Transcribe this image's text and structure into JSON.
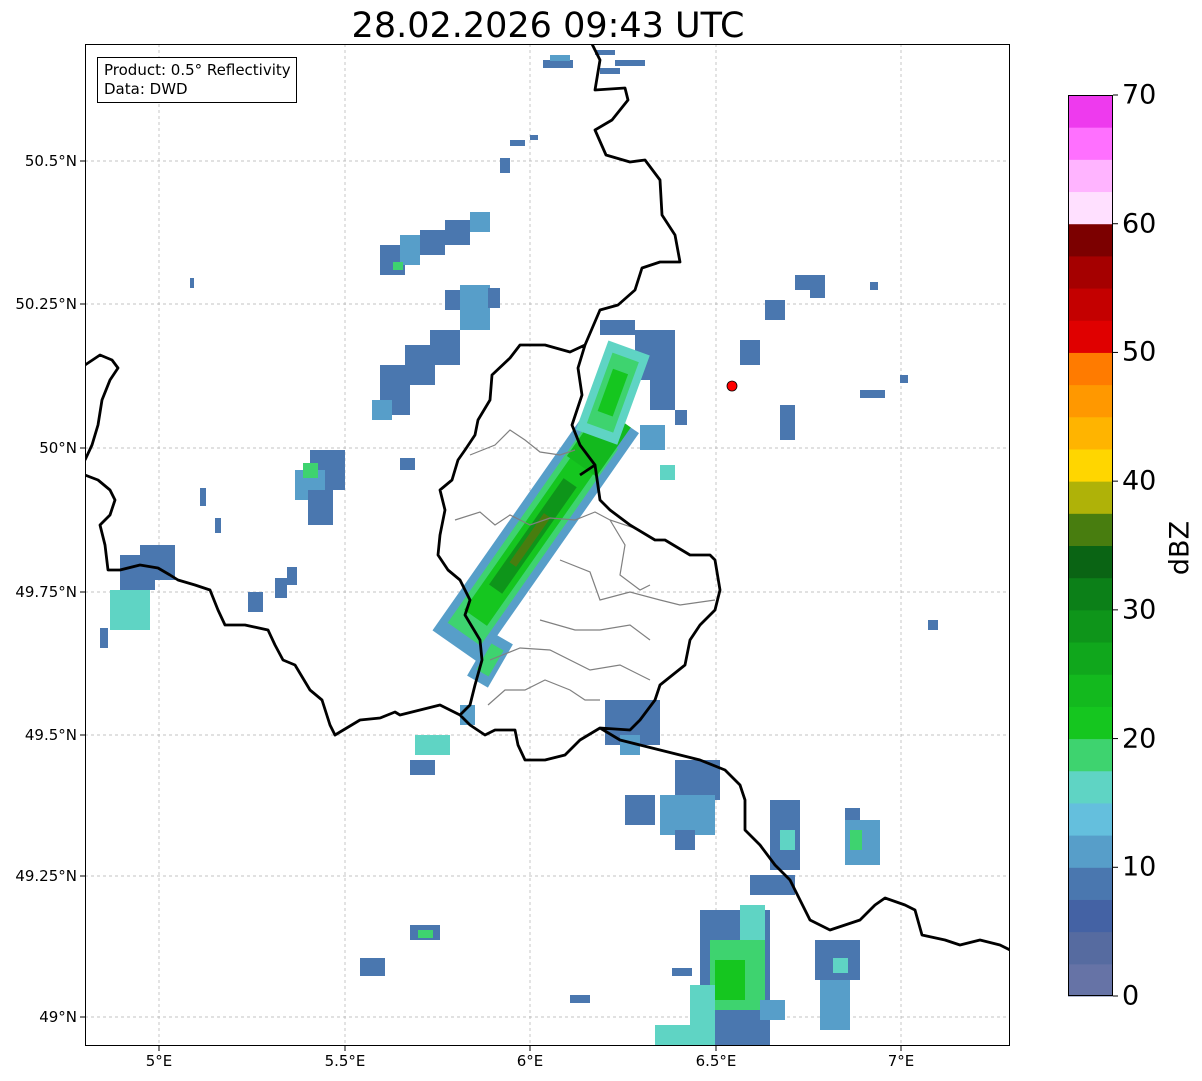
{
  "title": "28.02.2026 09:43 UTC",
  "infobox": {
    "product": "Product: 0.5° Reflectivity",
    "data": "Data: DWD"
  },
  "axes": {
    "x_ticks": [
      "5°E",
      "5.5°E",
      "6°E",
      "6.5°E",
      "7°E"
    ],
    "y_ticks": [
      "50.5°N",
      "50.25°N",
      "50°N",
      "49.75°N",
      "49.5°N",
      "49.25°N",
      "49°N"
    ]
  },
  "colorbar": {
    "label": "dBZ",
    "ticks": [
      "0",
      "10",
      "20",
      "30",
      "40",
      "50",
      "60",
      "70"
    ],
    "range": [
      0,
      70
    ],
    "colors": [
      "#6673a6",
      "#566ba0",
      "#4462a4",
      "#4a77af",
      "#579ec9",
      "#64bfdd",
      "#5fd4c4",
      "#3ed36f",
      "#15c61f",
      "#13b91e",
      "#10a71c",
      "#0e951a",
      "#0c8018",
      "#0a6414",
      "#487d0f",
      "#afb208",
      "#ffd600",
      "#ffb400",
      "#ff9800",
      "#ff7b00",
      "#e00000",
      "#c40000",
      "#a50000",
      "#7c0000",
      "#ffe0ff",
      "#ffb4ff",
      "#ff70ff",
      "#ee3aee"
    ]
  },
  "map": {
    "extent_lon": [
      4.8,
      7.3
    ],
    "extent_lat": [
      48.95,
      50.7
    ],
    "gridlines": true,
    "radar_site": {
      "lon": 6.55,
      "lat": 50.11,
      "color": "#ff0000"
    }
  }
}
